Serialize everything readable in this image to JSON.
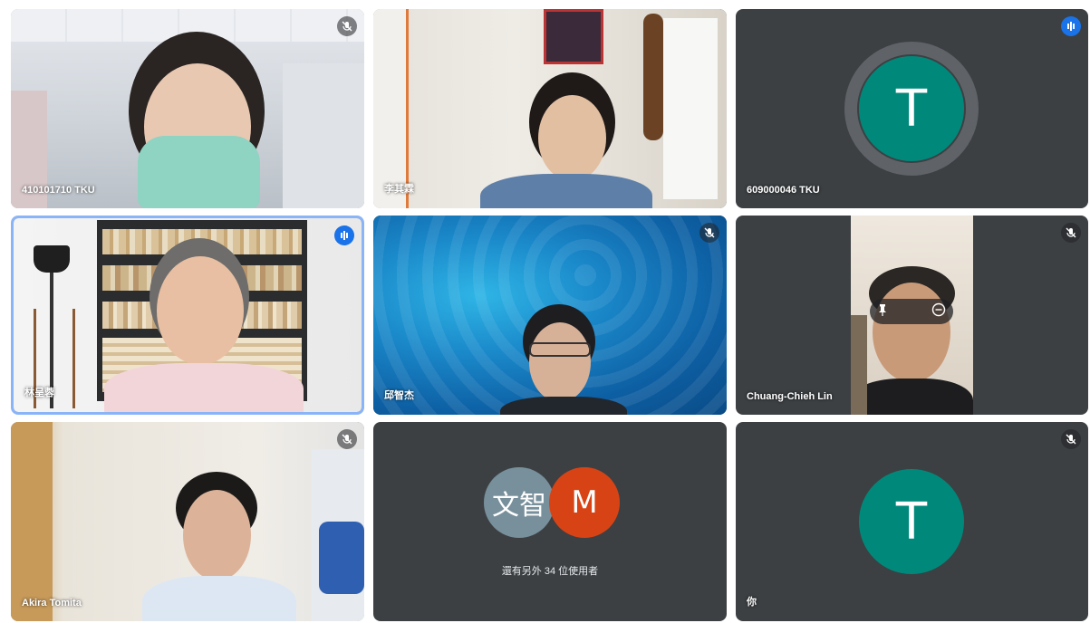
{
  "participants": [
    {
      "name": "410101710 TKU",
      "muted": true,
      "speaking": false
    },
    {
      "name": "李其霖",
      "muted": false,
      "speaking": false
    },
    {
      "name": "609000046 TKU",
      "muted": false,
      "speaking": true,
      "avatar_letter": "T"
    },
    {
      "name": "林呈蓉",
      "muted": false,
      "speaking": true,
      "active": true
    },
    {
      "name": "邱智杰",
      "muted": true,
      "speaking": false
    },
    {
      "name": "Chuang-Chieh Lin",
      "muted": true,
      "speaking": false
    },
    {
      "name": "Akira Tomita",
      "muted": true,
      "speaking": false
    },
    {
      "name": "",
      "muted": false,
      "speaking": false,
      "others_avatars": [
        "文智",
        "M"
      ],
      "others_label": "還有另外 34 位使用者"
    },
    {
      "name": "你",
      "muted": true,
      "speaking": false,
      "avatar_letter": "T"
    }
  ],
  "colors": {
    "tile_bg": "#3c4043",
    "avatar_green": "#00897b",
    "avatar_gray": "#78909c",
    "avatar_red": "#d84315",
    "active_border": "#8ab4f8",
    "speaking_blue": "#1a73e8"
  }
}
